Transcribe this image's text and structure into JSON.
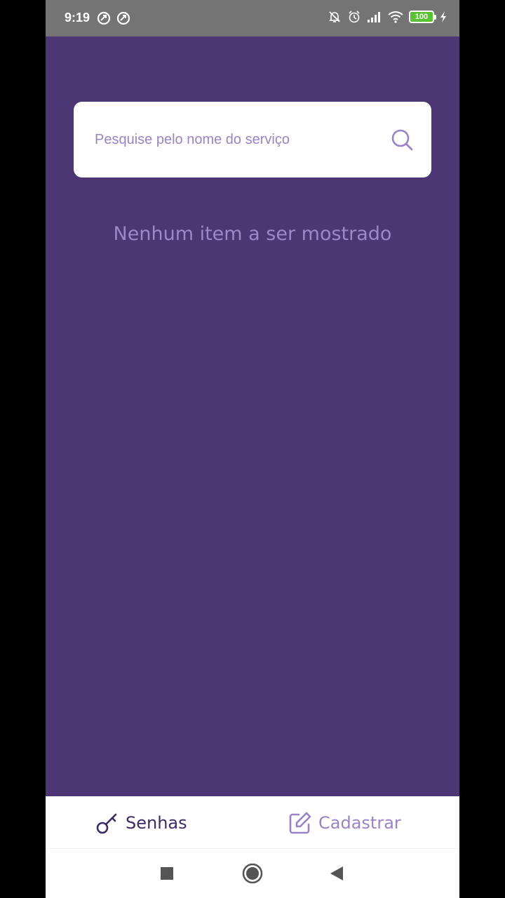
{
  "status_bar": {
    "time": "9:19",
    "battery": "100"
  },
  "search": {
    "placeholder": "Pesquise pelo nome do serviço",
    "icon": "search-icon"
  },
  "empty_state": {
    "message": "Nenhum item a ser mostrado"
  },
  "bottom_nav": {
    "tabs": [
      {
        "label": "Senhas",
        "icon": "key-icon",
        "active": true
      },
      {
        "label": "Cadastrar",
        "icon": "edit-icon",
        "active": false
      }
    ]
  },
  "colors": {
    "background": "#4C3774",
    "accent_active": "#3F2A69",
    "accent_inactive": "#9B82C9",
    "status_bar": "#747474"
  }
}
